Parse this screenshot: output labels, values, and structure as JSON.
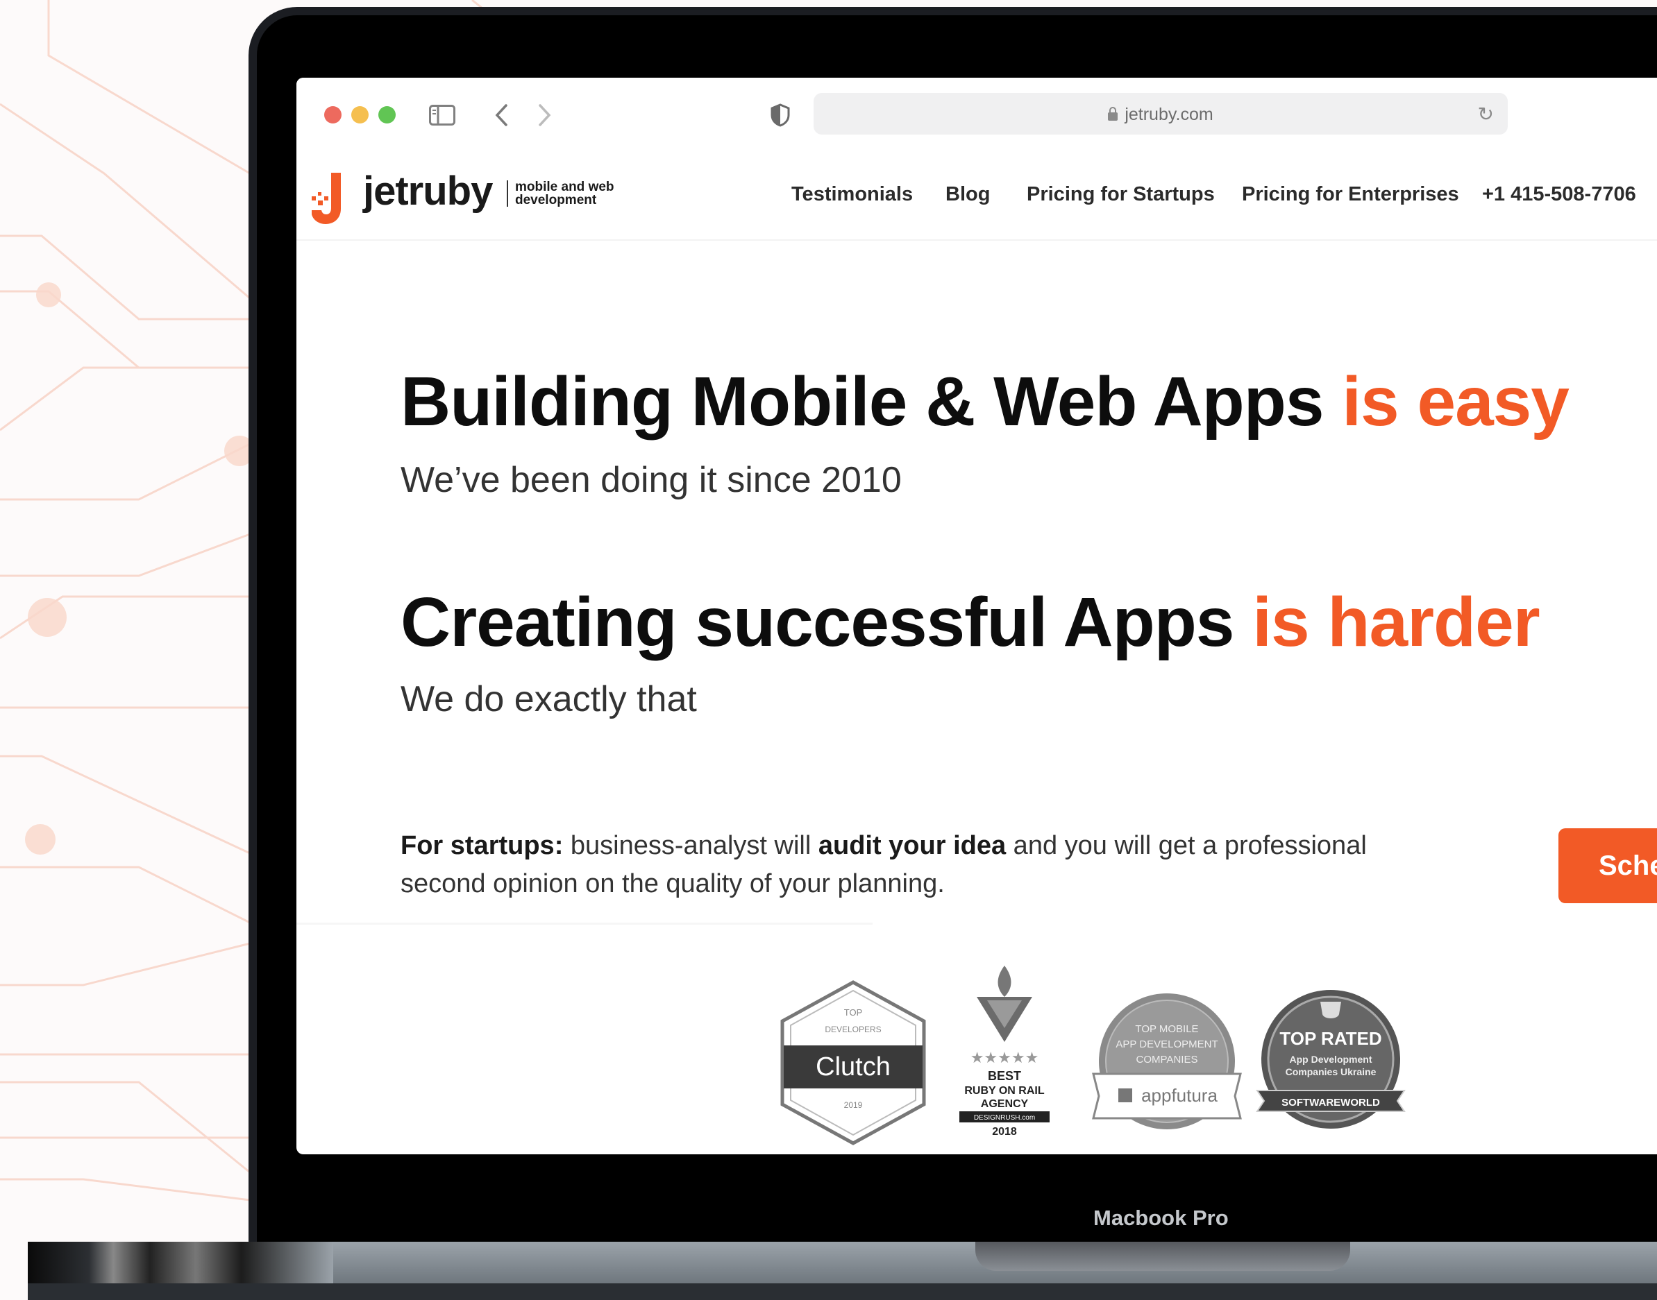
{
  "browser": {
    "url": "jetruby.com"
  },
  "site": {
    "brand": "jetruby",
    "tagline_line1": "mobile and web",
    "tagline_line2": "development",
    "nav": [
      {
        "label": "Testimonials"
      },
      {
        "label": "Blog"
      },
      {
        "label": "Pricing for Startups"
      },
      {
        "label": "Pricing for Enterprises"
      },
      {
        "label": "+1 415-508-7706"
      }
    ]
  },
  "hero": {
    "headline1_main": "Building Mobile & Web Apps ",
    "headline1_accent": "is easy",
    "sub1": "We’ve been doing it since 2010",
    "headline2_main": "Creating successful Apps ",
    "headline2_accent": "is harder",
    "sub2": "We do exactly that",
    "desc_bold1": "For startups:",
    "desc_text1": " business-analyst will ",
    "desc_bold2": "audit your idea",
    "desc_text2": " and you will get a professional second opinion on the quality of your planning.",
    "cta_label": "Sche"
  },
  "badges": {
    "clutch": {
      "top": "TOP",
      "developers": "DEVELOPERS",
      "name": "Clutch",
      "year": "2019"
    },
    "designrush": {
      "best": "BEST",
      "line2": "RUBY ON RAIL",
      "line3": "AGENCY",
      "site": "DESIGNRUSH.com",
      "year": "2018"
    },
    "appfutura": {
      "line1": "TOP MOBILE",
      "line2": "APP DEVELOPMENT",
      "line3": "COMPANIES",
      "name": "appfutura"
    },
    "softwareworld": {
      "title": "TOP RATED",
      "line2": "App Development",
      "line3": "Companies Ukraine",
      "name": "SOFTWAREWORLD"
    }
  },
  "device": {
    "label": "Macbook Pro"
  },
  "colors": {
    "accent": "#f25a26",
    "circuit": "#f7c7b6"
  }
}
